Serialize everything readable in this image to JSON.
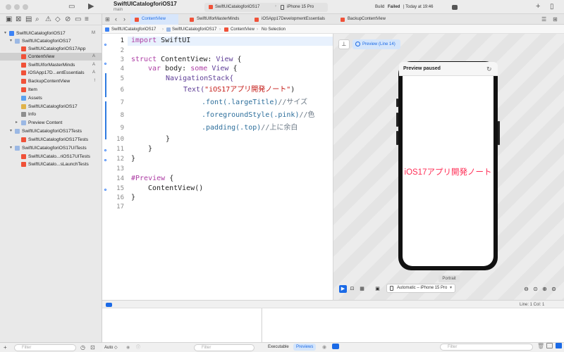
{
  "window": {
    "project_title": "SwiftUICatalogforiOS17",
    "branch": "main",
    "scheme": "SwiftUICatalogforiOS17",
    "device": "iPhone 15 Pro",
    "build_status": "Build",
    "build_result": "Failed",
    "build_time": "| Today at 19:46"
  },
  "tabs": [
    {
      "label": "ContentView"
    },
    {
      "label": "SwiftUIforMasterMinds"
    },
    {
      "label": "iOSApp17DevelopmentEssentials"
    },
    {
      "label": "BackupContentView"
    }
  ],
  "jumpbar": {
    "crumb1": "SwiftUICatalogforiOS17",
    "crumb2": "SwiftUICatalogforiOS17",
    "crumb3": "ContentView",
    "crumb4": "No Selection"
  },
  "sidebar": {
    "items": [
      {
        "label": "SwiftUICatalogforiOS17",
        "badge": "M"
      },
      {
        "label": "SwiftUICatalogforiOS17",
        "badge": ""
      },
      {
        "label": "SwiftUICatalogforiOS17App",
        "badge": ""
      },
      {
        "label": "ContentView",
        "badge": "A"
      },
      {
        "label": "SwiftUIforMasterMinds",
        "badge": "A"
      },
      {
        "label": "iOSApp17D...entEssentials",
        "badge": "A"
      },
      {
        "label": "BackupContentView",
        "badge": "!"
      },
      {
        "label": "Item",
        "badge": ""
      },
      {
        "label": "Assets",
        "badge": ""
      },
      {
        "label": "SwiftUICatalogforiOS17",
        "badge": ""
      },
      {
        "label": "Info",
        "badge": ""
      },
      {
        "label": "Preview Content",
        "badge": ""
      },
      {
        "label": "SwiftUICatalogforiOS17Tests",
        "badge": ""
      },
      {
        "label": "SwiftUICatalogforiOS17Tests",
        "badge": ""
      },
      {
        "label": "SwiftUICatalogforiOS17UITests",
        "badge": ""
      },
      {
        "label": "SwiftUICatalo...riOS17UITests",
        "badge": ""
      },
      {
        "label": "SwiftUICatalo...sLaunchTests",
        "badge": ""
      }
    ],
    "filter_placeholder": "Filter"
  },
  "editor": {
    "line_numbers": [
      "1",
      "2",
      "3",
      "4",
      "5",
      "6",
      "7",
      "8",
      "9",
      "10",
      "11",
      "12",
      "13",
      "14",
      "15",
      "16",
      "17"
    ],
    "code": {
      "l1_kw": "import",
      "l1_rest": " SwiftUI",
      "l3_kw": "struct",
      "l3_rest": " ContentView: ",
      "l3_type": "View",
      "l3_end": " {",
      "l4_kw": "var",
      "l4_rest": " body: ",
      "l4_kw2": "some",
      "l4_type": " View",
      "l4_end": " {",
      "l5": "NavigationStack{",
      "l6_pre": "Text(",
      "l6_str": "\"iOS17アプリ開発ノート\"",
      "l6_end": ")",
      "l7_fn": ".font(.largeTitle)",
      "l7_cm": "//サイズ",
      "l8_fn": ".foregroundStyle(.pink)",
      "l8_cm": "//色",
      "l9_fn": ".padding(.top)",
      "l9_cm": "//上に余白",
      "l10": "}",
      "l11": "}",
      "l12": "}",
      "l14_kw": "#Preview",
      "l14_end": " {",
      "l15": "ContentView()",
      "l16": "}"
    }
  },
  "canvas": {
    "preview_chip": "Preview (Line 14)",
    "paused_label": "Preview paused",
    "phone_text": "iOS17アプリ開発ノート",
    "portrait_label": "Portrait",
    "device_select": "Automatic – iPhone 15 Pro"
  },
  "debug": {
    "position": "Line: 1  Col: 1",
    "auto_label": "Auto ◇",
    "filter_placeholder": "Filter",
    "executable_label": "Executable",
    "previews_label": "Previews"
  },
  "colors": {
    "accent": "#1b6ae6",
    "error": "#c41a16",
    "pink": "#ff2d55",
    "swift_orange": "#f05138"
  }
}
